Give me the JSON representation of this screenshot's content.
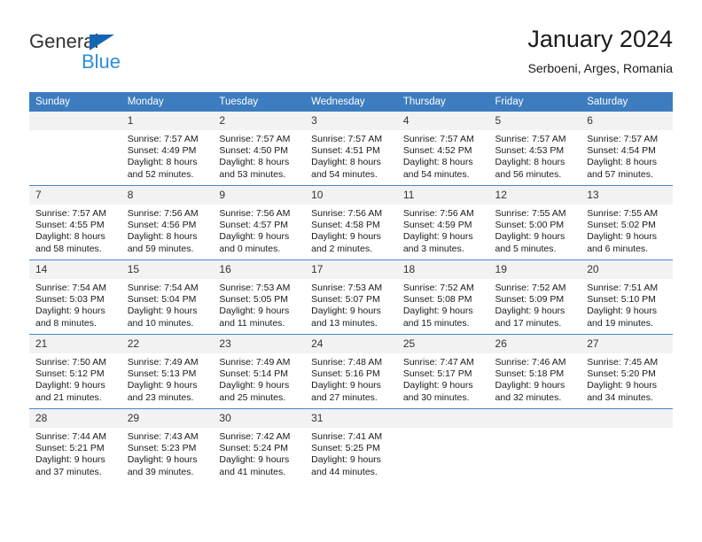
{
  "brand": {
    "name_part1": "General",
    "name_part2": "Blue",
    "accent_color": "#2b8ede",
    "triangle_color": "#1565b5"
  },
  "header": {
    "title": "January 2024",
    "subtitle": "Serboeni, Arges, Romania"
  },
  "calendar": {
    "header_bg": "#3c7cbf",
    "daynum_bg": "#f2f2f2",
    "weekday_headers": [
      "Sunday",
      "Monday",
      "Tuesday",
      "Wednesday",
      "Thursday",
      "Friday",
      "Saturday"
    ],
    "weeks": [
      [
        {
          "day": "",
          "sunrise": "",
          "sunset": "",
          "daylight1": "",
          "daylight2": ""
        },
        {
          "day": "1",
          "sunrise": "Sunrise: 7:57 AM",
          "sunset": "Sunset: 4:49 PM",
          "daylight1": "Daylight: 8 hours",
          "daylight2": "and 52 minutes."
        },
        {
          "day": "2",
          "sunrise": "Sunrise: 7:57 AM",
          "sunset": "Sunset: 4:50 PM",
          "daylight1": "Daylight: 8 hours",
          "daylight2": "and 53 minutes."
        },
        {
          "day": "3",
          "sunrise": "Sunrise: 7:57 AM",
          "sunset": "Sunset: 4:51 PM",
          "daylight1": "Daylight: 8 hours",
          "daylight2": "and 54 minutes."
        },
        {
          "day": "4",
          "sunrise": "Sunrise: 7:57 AM",
          "sunset": "Sunset: 4:52 PM",
          "daylight1": "Daylight: 8 hours",
          "daylight2": "and 54 minutes."
        },
        {
          "day": "5",
          "sunrise": "Sunrise: 7:57 AM",
          "sunset": "Sunset: 4:53 PM",
          "daylight1": "Daylight: 8 hours",
          "daylight2": "and 56 minutes."
        },
        {
          "day": "6",
          "sunrise": "Sunrise: 7:57 AM",
          "sunset": "Sunset: 4:54 PM",
          "daylight1": "Daylight: 8 hours",
          "daylight2": "and 57 minutes."
        }
      ],
      [
        {
          "day": "7",
          "sunrise": "Sunrise: 7:57 AM",
          "sunset": "Sunset: 4:55 PM",
          "daylight1": "Daylight: 8 hours",
          "daylight2": "and 58 minutes."
        },
        {
          "day": "8",
          "sunrise": "Sunrise: 7:56 AM",
          "sunset": "Sunset: 4:56 PM",
          "daylight1": "Daylight: 8 hours",
          "daylight2": "and 59 minutes."
        },
        {
          "day": "9",
          "sunrise": "Sunrise: 7:56 AM",
          "sunset": "Sunset: 4:57 PM",
          "daylight1": "Daylight: 9 hours",
          "daylight2": "and 0 minutes."
        },
        {
          "day": "10",
          "sunrise": "Sunrise: 7:56 AM",
          "sunset": "Sunset: 4:58 PM",
          "daylight1": "Daylight: 9 hours",
          "daylight2": "and 2 minutes."
        },
        {
          "day": "11",
          "sunrise": "Sunrise: 7:56 AM",
          "sunset": "Sunset: 4:59 PM",
          "daylight1": "Daylight: 9 hours",
          "daylight2": "and 3 minutes."
        },
        {
          "day": "12",
          "sunrise": "Sunrise: 7:55 AM",
          "sunset": "Sunset: 5:00 PM",
          "daylight1": "Daylight: 9 hours",
          "daylight2": "and 5 minutes."
        },
        {
          "day": "13",
          "sunrise": "Sunrise: 7:55 AM",
          "sunset": "Sunset: 5:02 PM",
          "daylight1": "Daylight: 9 hours",
          "daylight2": "and 6 minutes."
        }
      ],
      [
        {
          "day": "14",
          "sunrise": "Sunrise: 7:54 AM",
          "sunset": "Sunset: 5:03 PM",
          "daylight1": "Daylight: 9 hours",
          "daylight2": "and 8 minutes."
        },
        {
          "day": "15",
          "sunrise": "Sunrise: 7:54 AM",
          "sunset": "Sunset: 5:04 PM",
          "daylight1": "Daylight: 9 hours",
          "daylight2": "and 10 minutes."
        },
        {
          "day": "16",
          "sunrise": "Sunrise: 7:53 AM",
          "sunset": "Sunset: 5:05 PM",
          "daylight1": "Daylight: 9 hours",
          "daylight2": "and 11 minutes."
        },
        {
          "day": "17",
          "sunrise": "Sunrise: 7:53 AM",
          "sunset": "Sunset: 5:07 PM",
          "daylight1": "Daylight: 9 hours",
          "daylight2": "and 13 minutes."
        },
        {
          "day": "18",
          "sunrise": "Sunrise: 7:52 AM",
          "sunset": "Sunset: 5:08 PM",
          "daylight1": "Daylight: 9 hours",
          "daylight2": "and 15 minutes."
        },
        {
          "day": "19",
          "sunrise": "Sunrise: 7:52 AM",
          "sunset": "Sunset: 5:09 PM",
          "daylight1": "Daylight: 9 hours",
          "daylight2": "and 17 minutes."
        },
        {
          "day": "20",
          "sunrise": "Sunrise: 7:51 AM",
          "sunset": "Sunset: 5:10 PM",
          "daylight1": "Daylight: 9 hours",
          "daylight2": "and 19 minutes."
        }
      ],
      [
        {
          "day": "21",
          "sunrise": "Sunrise: 7:50 AM",
          "sunset": "Sunset: 5:12 PM",
          "daylight1": "Daylight: 9 hours",
          "daylight2": "and 21 minutes."
        },
        {
          "day": "22",
          "sunrise": "Sunrise: 7:49 AM",
          "sunset": "Sunset: 5:13 PM",
          "daylight1": "Daylight: 9 hours",
          "daylight2": "and 23 minutes."
        },
        {
          "day": "23",
          "sunrise": "Sunrise: 7:49 AM",
          "sunset": "Sunset: 5:14 PM",
          "daylight1": "Daylight: 9 hours",
          "daylight2": "and 25 minutes."
        },
        {
          "day": "24",
          "sunrise": "Sunrise: 7:48 AM",
          "sunset": "Sunset: 5:16 PM",
          "daylight1": "Daylight: 9 hours",
          "daylight2": "and 27 minutes."
        },
        {
          "day": "25",
          "sunrise": "Sunrise: 7:47 AM",
          "sunset": "Sunset: 5:17 PM",
          "daylight1": "Daylight: 9 hours",
          "daylight2": "and 30 minutes."
        },
        {
          "day": "26",
          "sunrise": "Sunrise: 7:46 AM",
          "sunset": "Sunset: 5:18 PM",
          "daylight1": "Daylight: 9 hours",
          "daylight2": "and 32 minutes."
        },
        {
          "day": "27",
          "sunrise": "Sunrise: 7:45 AM",
          "sunset": "Sunset: 5:20 PM",
          "daylight1": "Daylight: 9 hours",
          "daylight2": "and 34 minutes."
        }
      ],
      [
        {
          "day": "28",
          "sunrise": "Sunrise: 7:44 AM",
          "sunset": "Sunset: 5:21 PM",
          "daylight1": "Daylight: 9 hours",
          "daylight2": "and 37 minutes."
        },
        {
          "day": "29",
          "sunrise": "Sunrise: 7:43 AM",
          "sunset": "Sunset: 5:23 PM",
          "daylight1": "Daylight: 9 hours",
          "daylight2": "and 39 minutes."
        },
        {
          "day": "30",
          "sunrise": "Sunrise: 7:42 AM",
          "sunset": "Sunset: 5:24 PM",
          "daylight1": "Daylight: 9 hours",
          "daylight2": "and 41 minutes."
        },
        {
          "day": "31",
          "sunrise": "Sunrise: 7:41 AM",
          "sunset": "Sunset: 5:25 PM",
          "daylight1": "Daylight: 9 hours",
          "daylight2": "and 44 minutes."
        },
        {
          "day": "",
          "sunrise": "",
          "sunset": "",
          "daylight1": "",
          "daylight2": ""
        },
        {
          "day": "",
          "sunrise": "",
          "sunset": "",
          "daylight1": "",
          "daylight2": ""
        },
        {
          "day": "",
          "sunrise": "",
          "sunset": "",
          "daylight1": "",
          "daylight2": ""
        }
      ]
    ]
  }
}
